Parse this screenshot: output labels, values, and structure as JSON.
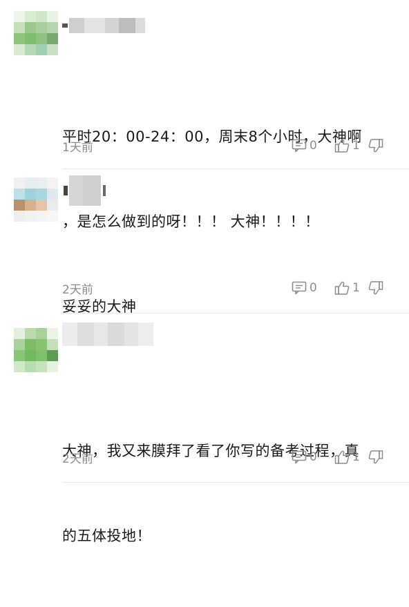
{
  "comments": [
    {
      "lines": [
        "平时20：00-24：00，周末8个小时，大神啊",
        "，是怎么做到的呀！！！ 大神！！！！"
      ],
      "time": "1天前",
      "reply_count": "0",
      "like_count": "1"
    },
    {
      "lines": [
        "妥妥的大神"
      ],
      "time": "2天前",
      "reply_count": "0",
      "like_count": "1"
    },
    {
      "lines": [
        "大神，我又来膜拜了看了你写的备考过程，真",
        "的五体投地！"
      ],
      "time": "2天前",
      "reply_count": "0",
      "like_count": "1"
    }
  ],
  "icons": {
    "reply": "comment-bubble-icon",
    "like": "thumbs-up-icon",
    "dislike": "thumbs-down-icon"
  },
  "colors": {
    "meta_text": "#8c8c8c",
    "content_text": "#191919",
    "divider": "#e6e6e6"
  }
}
